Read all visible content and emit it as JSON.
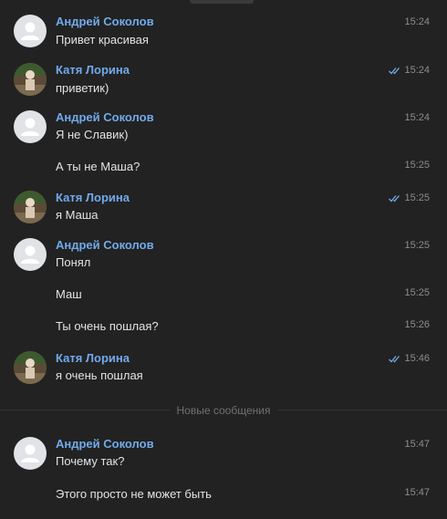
{
  "messages": [
    {
      "author": "Андрей Соколов",
      "text": "Привет красивая",
      "time": "15:24"
    },
    {
      "author": "Катя Лорина",
      "text": "приветик)",
      "time": "15:24"
    },
    {
      "author": "Андрей Соколов",
      "text": "Я не Славик)",
      "time": "15:24"
    },
    {
      "text": "А ты не Маша?",
      "time": "15:25"
    },
    {
      "author": "Катя Лорина",
      "text": "я Маша",
      "time": "15:25"
    },
    {
      "author": "Андрей Соколов",
      "text": "Понял",
      "time": "15:25"
    },
    {
      "text": "Маш",
      "time": "15:25"
    },
    {
      "text": "Ты очень пошлая?",
      "time": "15:26"
    },
    {
      "author": "Катя Лорина",
      "text": "я очень пошлая",
      "time": "15:46"
    },
    {
      "author": "Андрей Соколов",
      "text": "Почему так?",
      "time": "15:47"
    },
    {
      "text": "Этого просто не может быть",
      "time": "15:47"
    }
  ],
  "divider": {
    "label": "Новые сообщения"
  },
  "colors": {
    "author": "#71aaeb",
    "read_check": "#71aaeb",
    "background": "#222222"
  },
  "icons": {
    "read": "double-check-icon",
    "avatar_default": "default-user-avatar-icon",
    "avatar_photo": "user-photo-avatar"
  }
}
